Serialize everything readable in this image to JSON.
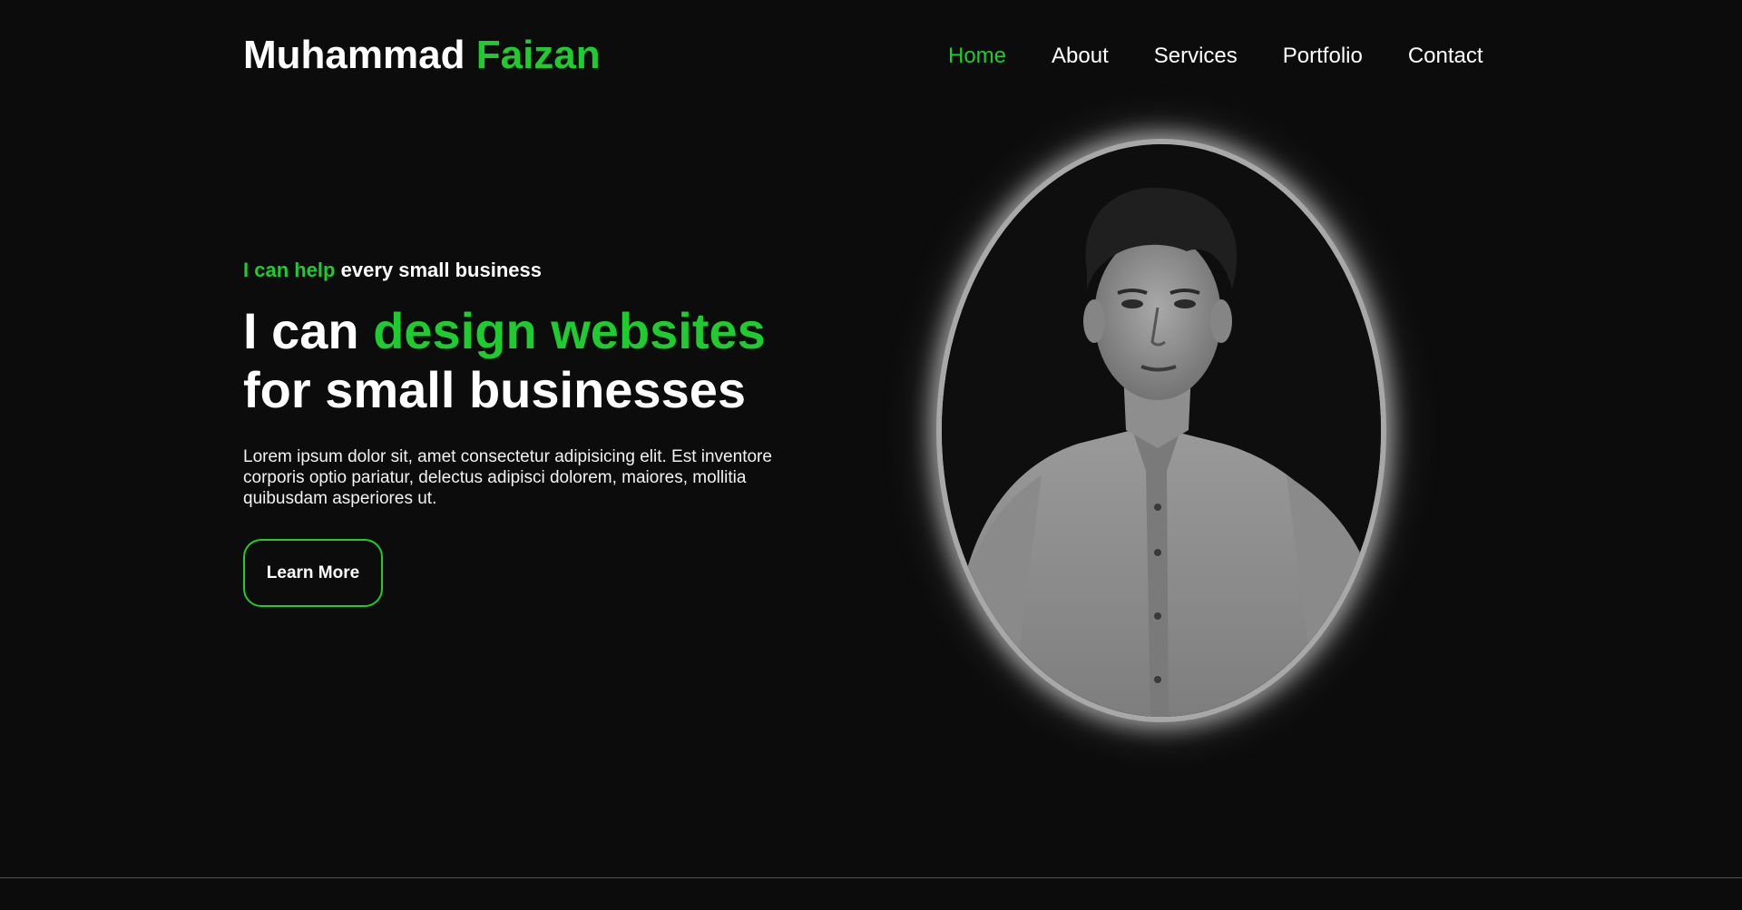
{
  "header": {
    "logo_first": "Muhammad",
    "logo_second": "Faizan",
    "nav": [
      {
        "label": "Home",
        "active": true
      },
      {
        "label": "About"
      },
      {
        "label": "Services"
      },
      {
        "label": "Portfolio"
      },
      {
        "label": "Contact"
      }
    ]
  },
  "hero": {
    "eyebrow_highlight": "I can help",
    "eyebrow_rest": "every small business",
    "headline_prefix": "I can",
    "headline_highlight": "design websites",
    "headline_line2": "for small businesses",
    "description": "Lorem ipsum dolor sit, amet consectetur adipisicing elit. Est inventore corporis optio pariatur, delectus adipisci dolorem, maiores, mollitia quibusdam asperiores ut.",
    "cta_label": "Learn More"
  },
  "portrait": {
    "icon": "profile-photo"
  },
  "colors": {
    "accent": "#1fcc2f",
    "background": "#0c0c0c",
    "text": "#ffffff"
  }
}
